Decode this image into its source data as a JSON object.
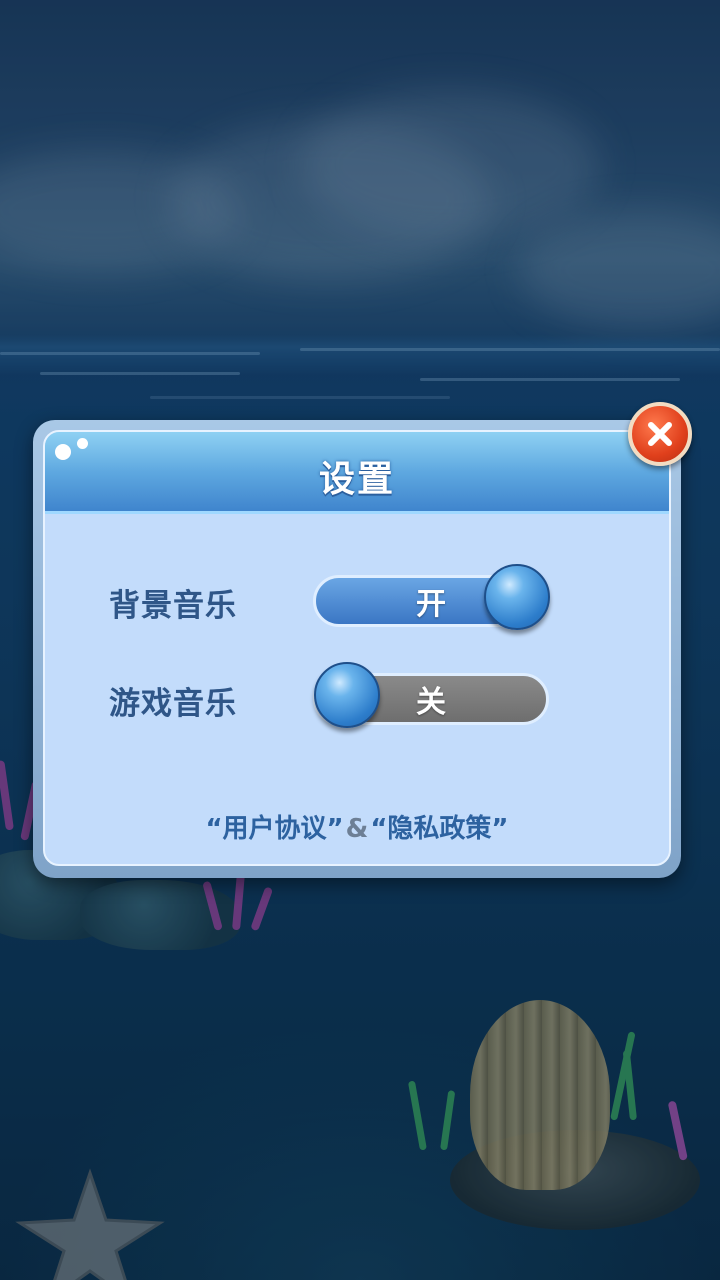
{
  "settings_dialog": {
    "title": "设置",
    "rows": [
      {
        "label": "背景音乐",
        "state_label": "开",
        "enabled": true
      },
      {
        "label": "游戏音乐",
        "state_label": "关",
        "enabled": false
      }
    ],
    "user_agreement_link": "“用户协议”",
    "connector": "&",
    "privacy_policy_link": "“隐私政策”"
  },
  "icons": {
    "close": "close-x-icon"
  },
  "colors": {
    "toggle_on": "#3a76c4",
    "toggle_off": "#6e6e6e",
    "close_button": "#e0401c",
    "label_text": "#2f5688"
  }
}
